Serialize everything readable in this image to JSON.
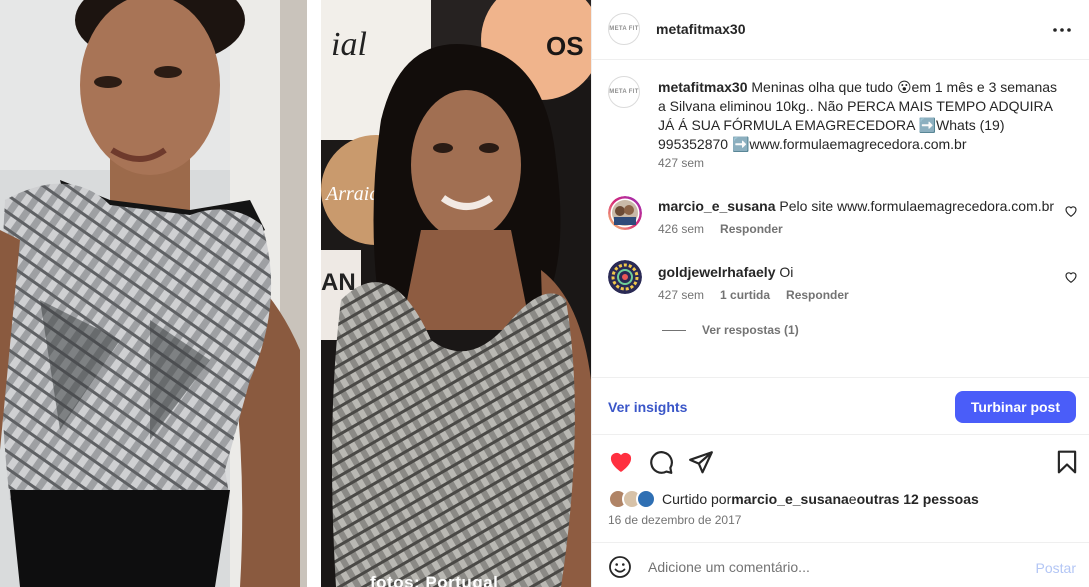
{
  "post": {
    "username": "metafitmax30",
    "avatar_text": "META FIT",
    "caption_username": "metafitmax30",
    "caption_text": " Meninas olha que tudo 😮em 1 mês e 3 semanas a Silvana eliminou 10kg.. Não PERCA MAIS TEMPO ADQUIRA JÁ Á SUA FÓRMULA EMAGRECEDORA ➡️Whats (19) 995352870 ➡️www.formulaemagrecedora.com.br",
    "caption_time": "427 sem",
    "photo_caption": "fotos: Portugal"
  },
  "comments": [
    {
      "username": "marcio_e_susana",
      "text": " Pelo site www.formulaemagrecedora.com.br",
      "time": "426 sem",
      "likes": "",
      "reply": "Responder"
    },
    {
      "username": "goldjewelrhafaely",
      "text": " Oi",
      "time": "427 sem",
      "likes": "1 curtida",
      "reply": "Responder",
      "view_replies": "Ver respostas (1)"
    }
  ],
  "insights": {
    "link": "Ver insights",
    "boost": "Turbinar post"
  },
  "likes": {
    "prefix": "Curtido por ",
    "user": "marcio_e_susana",
    "middle": " e ",
    "others": "outras 12 pessoas"
  },
  "date": "16 de dezembro de 2017",
  "composer": {
    "placeholder": "Adicione um comentário...",
    "post": "Postar"
  },
  "colors": {
    "like_red": "#ff3040",
    "boost_blue": "#4a5df9",
    "insights_blue": "#3a56c8"
  },
  "icons": [
    "more-icon",
    "heart-icon",
    "comment-icon",
    "share-icon",
    "bookmark-icon",
    "emoji-icon"
  ]
}
